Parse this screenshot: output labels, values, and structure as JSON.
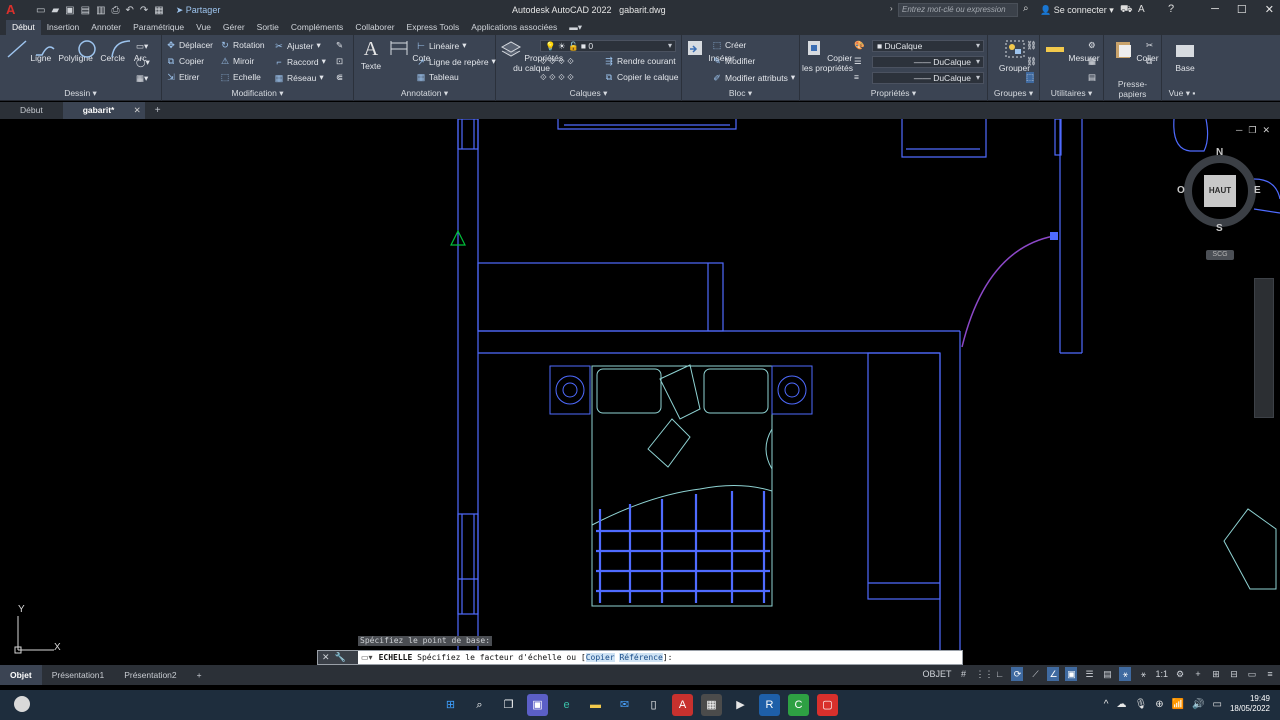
{
  "titlebar": {
    "app_title": "Autodesk AutoCAD 2022",
    "file_title": "gabarit.dwg",
    "share_label": "Partager",
    "search_placeholder": "Entrez mot-clé ou expression",
    "connect_label": "Se connecter"
  },
  "ribbon_tabs": [
    "Début",
    "Insertion",
    "Annoter",
    "Paramétrique",
    "Vue",
    "Gérer",
    "Sortie",
    "Compléments",
    "Collaborer",
    "Express Tools",
    "Applications associées"
  ],
  "ribbon": {
    "dessin": {
      "title": "Dessin",
      "ligne": "Ligne",
      "polyligne": "Polyligne",
      "cercle": "Cercle",
      "arc": "Arc"
    },
    "modification": {
      "title": "Modification",
      "deplacer": "Déplacer",
      "rotation": "Rotation",
      "ajuster": "Ajuster",
      "copier": "Copier",
      "miroir": "Miroir",
      "raccord": "Raccord",
      "etirer": "Etirer",
      "echelle": "Echelle",
      "reseau": "Réseau"
    },
    "annotation": {
      "title": "Annotation",
      "texte": "Texte",
      "cote": "Cote",
      "lineaire": "Linéaire",
      "ligne_repere": "Ligne de repère",
      "tableau": "Tableau"
    },
    "calques": {
      "title": "Calques",
      "proprietes": "Propriétés",
      "du_calque": "du calque",
      "layer_value": "0",
      "rendre_courant": "Rendre courant",
      "copier_calque": "Copier le calque"
    },
    "bloc": {
      "title": "Bloc",
      "inserer": "Insérer",
      "creer": "Créer",
      "modifier": "Modifier",
      "modifier_attributs": "Modifier attributs"
    },
    "proprietes": {
      "title": "Propriétés",
      "copier": "Copier",
      "les_proprietes": "les propriétés",
      "color": "DuCalque",
      "linetype": "DuCalque",
      "lineweight": "DuCalque"
    },
    "groupes": {
      "title": "Groupes",
      "grouper": "Grouper"
    },
    "utilitaires": {
      "title": "Utilitaires",
      "mesurer": "Mesurer"
    },
    "presse_papiers": {
      "title": "Presse-papiers",
      "coller": "Coller"
    },
    "vue": {
      "title": "Vue",
      "base": "Base"
    }
  },
  "file_tabs": {
    "start": "Début",
    "active": "gabarit*"
  },
  "viewcube": {
    "n": "N",
    "s": "S",
    "o": "O",
    "e": "E",
    "top": "HAUT",
    "scg": "SCG"
  },
  "ucs": {
    "x": "X",
    "y": "Y"
  },
  "tooltip": "Spécifiez le point de base:",
  "command": {
    "name": "ECHELLE",
    "prompt": "Spécifiez le facteur d'échelle ou [",
    "opt1": "Copier",
    "opt2": "Référence",
    "end": "]:"
  },
  "layout_tabs": [
    "Objet",
    "Présentation1",
    "Présentation2"
  ],
  "status": {
    "mode": "OBJET",
    "scale": "1:1"
  },
  "clock": {
    "time": "19:49",
    "date": "18/05/2022"
  }
}
